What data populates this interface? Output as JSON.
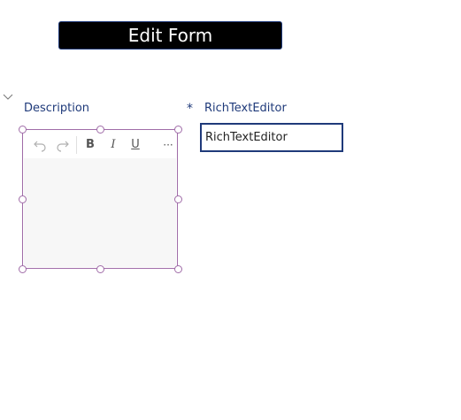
{
  "header": {
    "edit_form_label": "Edit Form"
  },
  "form": {
    "description_label": "Description",
    "rte_label": "RichTextEditor",
    "required_marker": "*",
    "rte_value": "RichTextEditor"
  },
  "editor": {
    "toolbar": {
      "undo_icon": "undo-icon",
      "redo_icon": "redo-icon",
      "bold": "B",
      "italic": "I",
      "underline": "U",
      "more": "···"
    }
  },
  "colors": {
    "accent": "#1f3a7a",
    "selection": "#a06ca8",
    "button_bg": "#000000"
  }
}
